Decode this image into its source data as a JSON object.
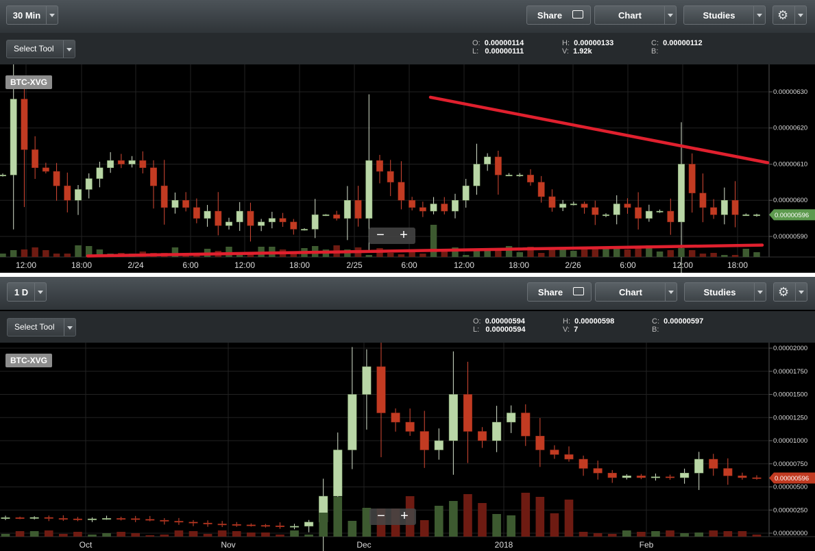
{
  "top": {
    "interval_label": "30 Min",
    "share_label": "Share",
    "chart_label": "Chart",
    "studies_label": "Studies",
    "select_tool_label": "Select Tool",
    "ohlc": {
      "o_label": "O:",
      "o": "0.00000114",
      "l_label": "L:",
      "l": "0.00000111",
      "h_label": "H:",
      "h": "0.00000133",
      "v_label": "V:",
      "v": "1.92k",
      "c_label": "C:",
      "c": "0.00000112",
      "b_label": "B:"
    },
    "symbol": "BTC-XVG",
    "price_tag": "0.00000596",
    "price_tag_color": "#5d9a4e"
  },
  "bottom": {
    "interval_label": "1 D",
    "share_label": "Share",
    "chart_label": "Chart",
    "studies_label": "Studies",
    "select_tool_label": "Select Tool",
    "ohlc": {
      "o_label": "O:",
      "o": "0.00000594",
      "l_label": "L:",
      "l": "0.00000594",
      "h_label": "H:",
      "h": "0.00000598",
      "v_label": "V:",
      "v": "7",
      "c_label": "C:",
      "c": "0.00000597",
      "b_label": "B:"
    },
    "symbol": "BTC-XVG",
    "price_tag": "0.00000596",
    "price_tag_color": "#c23b22"
  },
  "zoom": {
    "minus": "−",
    "plus": "+"
  },
  "colors": {
    "up": "#b9d6a6",
    "down": "#c23b22",
    "vol_up": "#3d5a30",
    "vol_down": "#6e1b12",
    "trendline": "#e0202e",
    "grid": "#222"
  },
  "chart_data": [
    {
      "type": "candlestick",
      "title": "BTC-XVG",
      "interval": "30 Min",
      "x_tick_labels": [
        "12:00",
        "18:00",
        "2/24",
        "6:00",
        "12:00",
        "18:00",
        "2/25",
        "6:00",
        "12:00",
        "18:00",
        "2/26",
        "6:00",
        "12:00",
        "18:00"
      ],
      "y_tick_labels": [
        "0.00000630",
        "0.00000620",
        "0.00000610",
        "0.00000600",
        "0.00000590"
      ],
      "ylim": [
        5.845e-06,
        6.3e-06
      ],
      "current_price": 5.96e-06,
      "trendlines": [
        {
          "name": "resistance",
          "from": {
            "x": "2/25 07:00",
            "y": 6.285e-06
          },
          "to": {
            "x": "2/26 21:00",
            "y": 6.104e-06
          }
        },
        {
          "name": "support",
          "from": {
            "x": "2/23 19:30",
            "y": 5.846e-06
          },
          "to": {
            "x": "2/26 21:00",
            "y": 5.876e-06
          }
        }
      ],
      "trend_points": [
        [
          6.07e-06,
          6.28e-06,
          6.14e-06,
          6.09e-06,
          6.08e-06,
          6.04e-06,
          6e-06,
          6.03e-06,
          6.06e-06,
          6.09e-06,
          6.11e-06,
          6.1e-06,
          6.11e-06,
          6.09e-06,
          6.04e-06,
          5.98e-06,
          6e-06,
          5.98e-06,
          5.95e-06,
          5.97e-06,
          5.93e-06,
          5.94e-06,
          5.97e-06,
          5.93e-06,
          5.94e-06,
          5.95e-06,
          5.94e-06,
          5.92e-06,
          5.92e-06,
          5.96e-06,
          5.96e-06,
          5.95e-06,
          6e-06,
          5.95e-06,
          6.11e-06,
          6.08e-06,
          6.05e-06,
          6e-06,
          5.98e-06,
          5.97e-06,
          5.99e-06,
          5.97e-06,
          6e-06,
          6.04e-06,
          6.1e-06,
          6.12e-06,
          6.07e-06,
          6.07e-06,
          6.07e-06,
          6.05e-06,
          6.01e-06,
          5.98e-06,
          5.99e-06,
          5.99e-06,
          5.98e-06,
          5.96e-06,
          5.96e-06,
          5.99e-06,
          5.98e-06,
          5.95e-06,
          5.97e-06,
          5.97e-06,
          5.94e-06,
          6.1e-06,
          6.02e-06,
          5.98e-06,
          5.96e-06,
          6e-06,
          5.96e-06,
          5.96e-06,
          5.96e-06
        ]
      ]
    },
    {
      "type": "candlestick",
      "title": "BTC-XVG",
      "interval": "1 D",
      "x_tick_labels": [
        "Oct",
        "Nov",
        "Dec",
        "2018",
        "Feb"
      ],
      "y_tick_labels": [
        "0.00002000",
        "0.00001750",
        "0.00001500",
        "0.00001250",
        "0.00001000",
        "0.00000750",
        "0.00000500",
        "0.00000250",
        "0.00000000"
      ],
      "ylim": [
        0,
        2e-05
      ],
      "current_price": 5.96e-06,
      "closes": [
        1.68e-06,
        1.65e-06,
        1.7e-06,
        1.6e-06,
        1.55e-06,
        1.5e-06,
        1.55e-06,
        1.6e-06,
        1.58e-06,
        1.5e-06,
        1.4e-06,
        1.3e-06,
        1.2e-06,
        1.1e-06,
        1e-06,
        9.5e-07,
        9e-07,
        8.5e-07,
        8e-07,
        7e-07,
        7.5e-07,
        1.2e-06,
        4e-06,
        9e-06,
        1.5e-05,
        1.8e-05,
        1.3e-05,
        1.2e-05,
        1.1e-05,
        9e-06,
        1e-05,
        1.5e-05,
        1.1e-05,
        1e-05,
        1.2e-05,
        1.3e-05,
        1.05e-05,
        9e-06,
        8.5e-06,
        8e-06,
        7e-06,
        6.5e-06,
        6e-06,
        6.2e-06,
        6e-06,
        6.1e-06,
        6e-06,
        6.5e-06,
        8e-06,
        7e-06,
        6.2e-06,
        6e-06,
        5.96e-06
      ]
    }
  ]
}
